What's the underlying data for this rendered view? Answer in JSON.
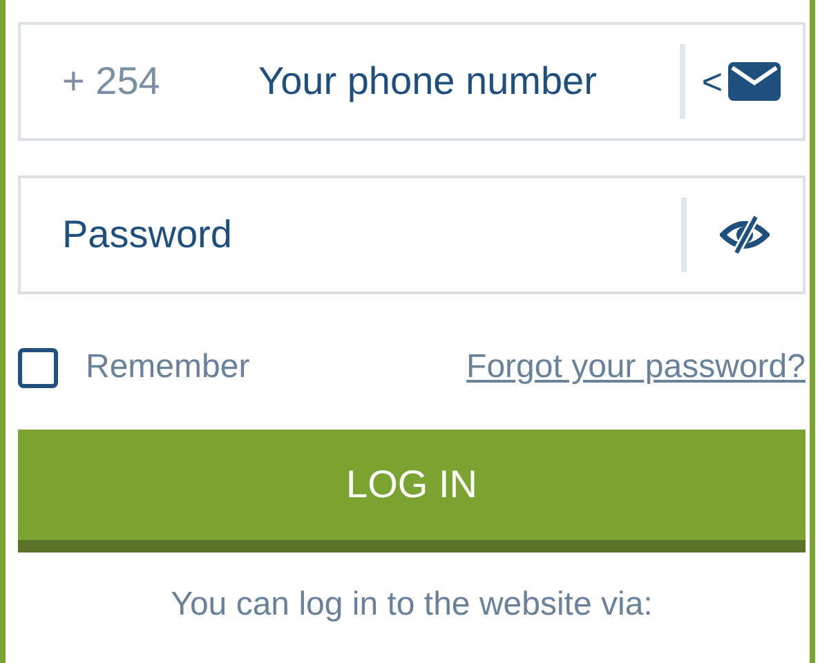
{
  "phone": {
    "prefix": "+ 254",
    "placeholder": "Your phone number",
    "switch_glyph": "<"
  },
  "password": {
    "placeholder": "Password"
  },
  "remember": {
    "label": "Remember",
    "checked": false
  },
  "forgot_link": "Forgot your password?",
  "login_button": "LOG IN",
  "footer_text": "You can log in to the website via:"
}
